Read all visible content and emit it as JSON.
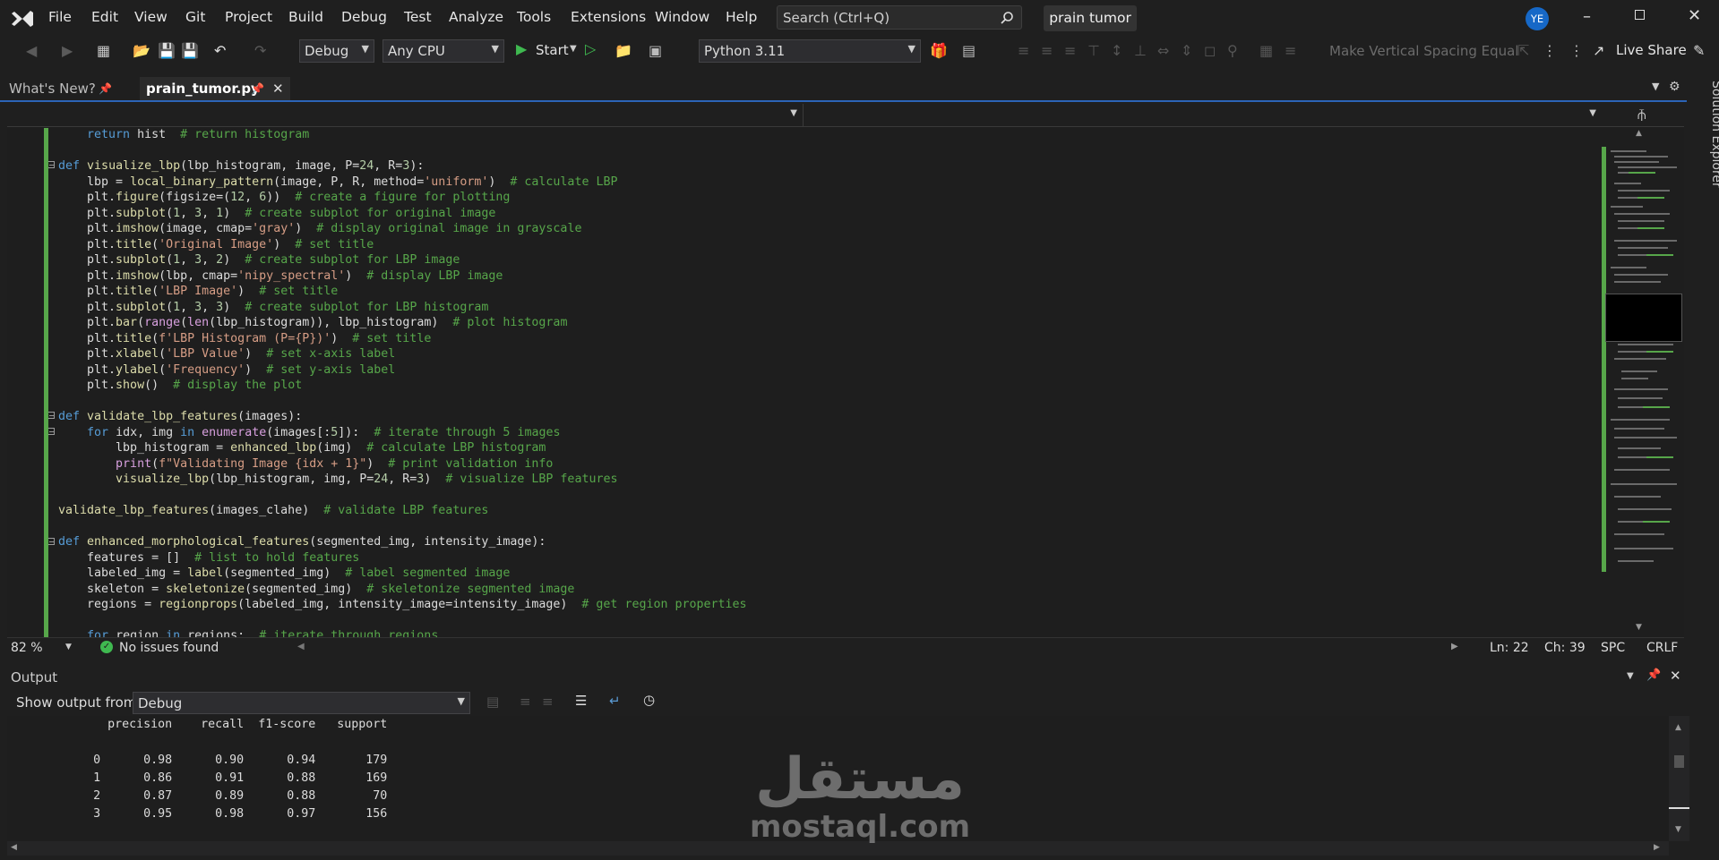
{
  "menu": [
    "File",
    "Edit",
    "View",
    "Git",
    "Project",
    "Build",
    "Debug",
    "Test",
    "Analyze",
    "Tools",
    "Extensions",
    "Window",
    "Help"
  ],
  "search": {
    "placeholder": "Search (Ctrl+Q)"
  },
  "project_title": "prain tumor",
  "user_initials": "YE",
  "toolbar": {
    "config": "Debug",
    "platform": "Any CPU",
    "start_label": "Start",
    "python_env": "Python 3.11",
    "vertical_spacing": "Make Vertical Spacing Equal",
    "live_share": "Live Share"
  },
  "tabs": [
    {
      "label": "What's New?"
    },
    {
      "label": "prain_tumor.py"
    }
  ],
  "side_panel": "Solution Explorer",
  "editor": {
    "zoom": "82 %",
    "issues": "No issues found",
    "ln": "Ln: 22",
    "ch": "Ch: 39",
    "spc": "SPC",
    "crlf": "CRLF"
  },
  "output": {
    "title": "Output",
    "show_from_label": "Show output from:",
    "source": "Debug",
    "header": {
      "precision": "precision",
      "recall": "recall",
      "f1": "f1-score",
      "support": "support"
    },
    "rows": [
      {
        "cls": "0",
        "precision": "0.98",
        "recall": "0.90",
        "f1": "0.94",
        "support": "179"
      },
      {
        "cls": "1",
        "precision": "0.86",
        "recall": "0.91",
        "f1": "0.88",
        "support": "169"
      },
      {
        "cls": "2",
        "precision": "0.87",
        "recall": "0.89",
        "f1": "0.88",
        "support": "70"
      },
      {
        "cls": "3",
        "precision": "0.95",
        "recall": "0.98",
        "f1": "0.97",
        "support": "156"
      }
    ]
  },
  "watermark": {
    "arabic": "مستقل",
    "latin": "mostaql.com"
  },
  "code_lines": [
    "    return hist  # return histogram",
    "",
    "def visualize_lbp(lbp_histogram, image, P=24, R=3):",
    "    lbp = local_binary_pattern(image, P, R, method='uniform')  # calculate LBP",
    "    plt.figure(figsize=(12, 6))  # create a figure for plotting",
    "    plt.subplot(1, 3, 1)  # create subplot for original image",
    "    plt.imshow(image, cmap='gray')  # display original image in grayscale",
    "    plt.title('Original Image')  # set title",
    "    plt.subplot(1, 3, 2)  # create subplot for LBP image",
    "    plt.imshow(lbp, cmap='nipy_spectral')  # display LBP image",
    "    plt.title('LBP Image')  # set title",
    "    plt.subplot(1, 3, 3)  # create subplot for LBP histogram",
    "    plt.bar(range(len(lbp_histogram)), lbp_histogram)  # plot histogram",
    "    plt.title(f'LBP Histogram (P={P})')  # set title",
    "    plt.xlabel('LBP Value')  # set x-axis label",
    "    plt.ylabel('Frequency')  # set y-axis label",
    "    plt.show()  # display the plot",
    "",
    "def validate_lbp_features(images):",
    "    for idx, img in enumerate(images[:5]):  # iterate through 5 images",
    "        lbp_histogram = enhanced_lbp(img)  # calculate LBP histogram",
    "        print(f\"Validating Image {idx + 1}\")  # print validation info",
    "        visualize_lbp(lbp_histogram, img, P=24, R=3)  # visualize LBP features",
    "",
    "validate_lbp_features(images_clahe)  # validate LBP features",
    "",
    "def enhanced_morphological_features(segmented_img, intensity_image):",
    "    features = []  # list to hold features",
    "    labeled_img = label(segmented_img)  # label segmented image",
    "    skeleton = skeletonize(segmented_img)  # skeletonize segmented image",
    "    regions = regionprops(labeled_img, intensity_image=intensity_image)  # get region properties",
    "",
    "    for region in regions:  # iterate through regions"
  ]
}
